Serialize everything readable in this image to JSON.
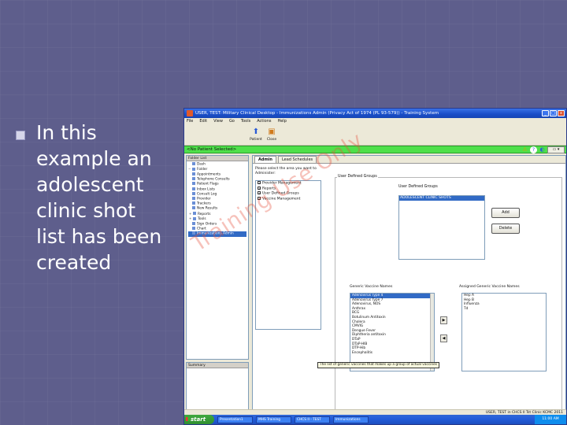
{
  "slide": {
    "bullet_lines": [
      "In this",
      "example an",
      "adolescent",
      "clinic shot",
      "list has been",
      "created"
    ]
  },
  "app": {
    "title": "USER, TEST: Military Clinical Desktop - Immunizations Admin (Privacy Act of 1974 (PL 93-579)) - Training System",
    "menu": [
      "File",
      "Edit",
      "View",
      "Go",
      "Tools",
      "Actions",
      "Help"
    ],
    "toolbar": [
      {
        "label": "Patient",
        "icon": "patient-icon"
      },
      {
        "label": "Close",
        "icon": "close-doc-icon"
      }
    ],
    "patient_bar": "<No Patient Selected>",
    "folder_list_label": "Folder List",
    "tree": [
      {
        "label": "Dash",
        "exp": ""
      },
      {
        "label": "Folder",
        "exp": "−"
      },
      {
        "label": "Appointments",
        "exp": ""
      },
      {
        "label": "Telephone Consults",
        "exp": ""
      },
      {
        "label": "Patient Flags",
        "exp": ""
      },
      {
        "label": "Inbox Lists",
        "exp": ""
      },
      {
        "label": "Consult Log",
        "exp": ""
      },
      {
        "label": "Provider",
        "exp": ""
      },
      {
        "label": "Trackers",
        "exp": ""
      },
      {
        "label": "New Results",
        "exp": ""
      },
      {
        "label": "Reports",
        "exp": "+"
      },
      {
        "label": "Tools",
        "exp": "+"
      },
      {
        "label": "Sign Orders",
        "exp": ""
      },
      {
        "label": "Chart",
        "exp": ""
      },
      {
        "label": "Immunizations Admin",
        "exp": ""
      }
    ],
    "second_panel_label": "Summary",
    "tabs": [
      "Admin",
      "Lead Schedules"
    ],
    "prompt": "Please select the area you want to Administer:",
    "options": [
      {
        "label": "Provider Management",
        "checked": true
      },
      {
        "label": "Reports",
        "checked": true
      },
      {
        "label": "User Defined Groups",
        "checked": true
      },
      {
        "label": "Vaccine Management",
        "checked": true
      }
    ],
    "udg_legend": "User Defined Groups",
    "udg_label": "User Defined Groups",
    "udg_items": [
      "ADOLESCENT CLINIC SHOTS"
    ],
    "add_label": "Add",
    "delete_label": "Delete",
    "generic_label": "Generic Vaccine Names",
    "assigned_label": "Assigned Generic Vaccine Names",
    "generic_items": [
      "Adenovirus Type 4",
      "Adenovirus Type 7",
      "Adenovirus, NOS",
      "Anthrax",
      "BCG",
      "Botulinum Antitoxin",
      "Cholera",
      "CMVIG",
      "Dengue Fever",
      "Diphtheria antitoxin",
      "DTaP",
      "DTaP-HIB",
      "DTP-Hib",
      "Encephalitis"
    ],
    "assigned_items": [
      "Hep A",
      "Hep B",
      "Influenza",
      "Td"
    ],
    "move_right": "▶",
    "move_left": "◀",
    "tooltip": "The list of generic vaccines that makes up a group of actual vaccines",
    "status_text": "USER, TEST in CHCS II Tst Clinic KCMC 2011",
    "taskbar_tasks": [
      "Presentation1",
      "MHS Training",
      "CHCS II - TEST",
      "Immunizations"
    ],
    "clock": "11:00 AM",
    "start_label": "start",
    "watermark": "Training Use Only"
  }
}
